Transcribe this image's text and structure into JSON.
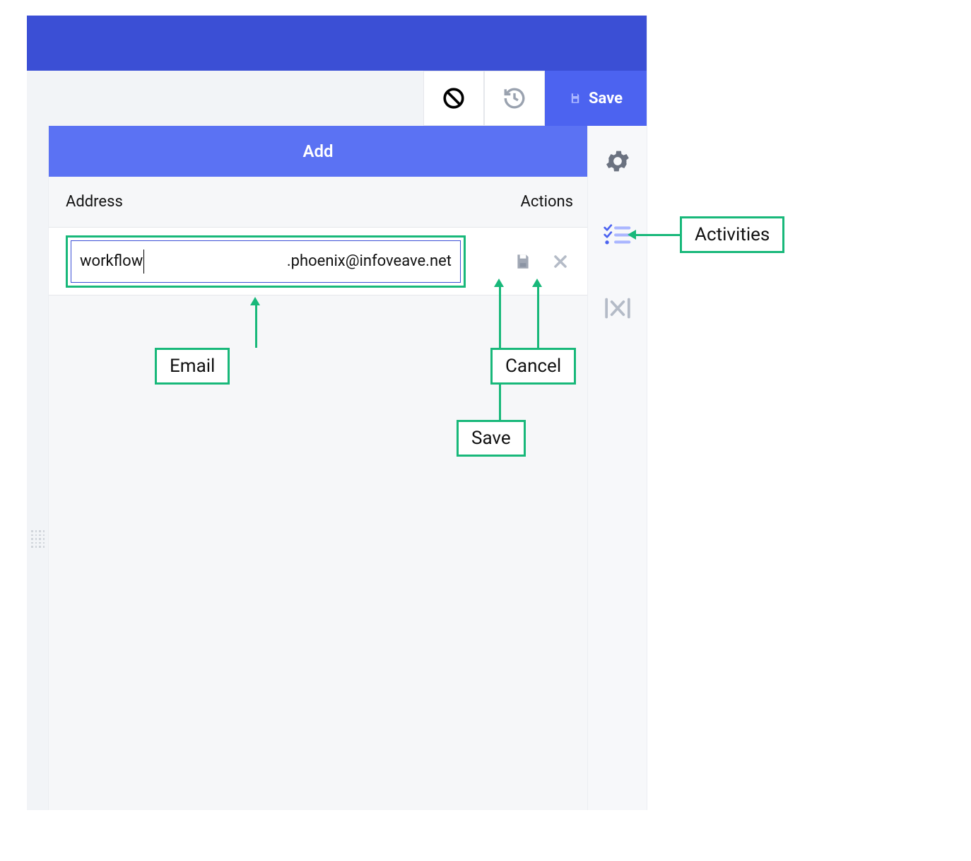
{
  "toolbar": {
    "save_label": "Save"
  },
  "panel": {
    "header_label": "Add",
    "columns": {
      "address": "Address",
      "actions": "Actions"
    },
    "row": {
      "email_prefix": "workflow",
      "email_suffix": ".phoenix@infoveave.net"
    }
  },
  "rail": {
    "icons": [
      "settings",
      "activities",
      "abs"
    ]
  },
  "callouts": {
    "activities": "Activities",
    "email": "Email",
    "save": "Save",
    "cancel": "Cancel"
  }
}
